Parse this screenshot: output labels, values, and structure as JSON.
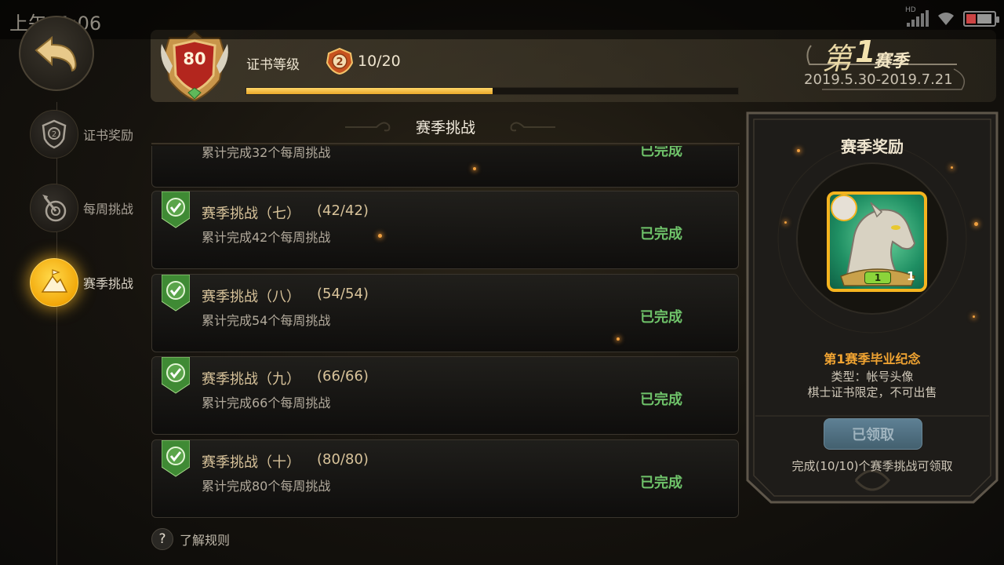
{
  "status_bar": {
    "time": "上午11:06",
    "network_label": "HD"
  },
  "nav": {
    "back_icon": "back-arrow-icon",
    "items": [
      {
        "label": "证书奖励",
        "icon": "certificate-shield-icon",
        "active": false
      },
      {
        "label": "每周挑战",
        "icon": "target-dart-icon",
        "active": false
      },
      {
        "label": "赛季挑战",
        "icon": "mountain-flag-icon",
        "active": true
      }
    ]
  },
  "header": {
    "level": "80",
    "cert_label": "证书等级",
    "cert_progress": "10/20",
    "progress_fraction": 0.5,
    "season_prefix": "第",
    "season_number": "1",
    "season_suffix": "赛季",
    "season_dates": "2019.5.30-2019.7.21"
  },
  "challenges": {
    "title": "赛季挑战",
    "partial_item": {
      "desc": "累计完成32个每周挑战",
      "status": "已完成"
    },
    "items": [
      {
        "title": "赛季挑战（七）",
        "count": "(42/42)",
        "desc": "累计完成42个每周挑战",
        "status": "已完成"
      },
      {
        "title": "赛季挑战（八）",
        "count": "(54/54)",
        "desc": "累计完成54个每周挑战",
        "status": "已完成"
      },
      {
        "title": "赛季挑战（九）",
        "count": "(66/66)",
        "desc": "累计完成66个每周挑战",
        "status": "已完成"
      },
      {
        "title": "赛季挑战（十）",
        "count": "(80/80)",
        "desc": "累计完成80个每周挑战",
        "status": "已完成"
      }
    ],
    "rules_icon": "?",
    "rules_label": "了解规则"
  },
  "reward": {
    "title": "赛季奖励",
    "name": "第1赛季毕业纪念",
    "type": "类型：帐号头像",
    "limit": "棋士证书限定，不可出售",
    "avatar_level": "1",
    "avatar_count": "1",
    "claim_label": "已领取",
    "claim_condition": "完成(10/10)个赛季挑战可领取"
  },
  "colors": {
    "accent_gold": "#f5b41f",
    "complete_green": "#6fc36a",
    "reward_orange": "#f1a432",
    "progress_fill": "#f0b440"
  }
}
